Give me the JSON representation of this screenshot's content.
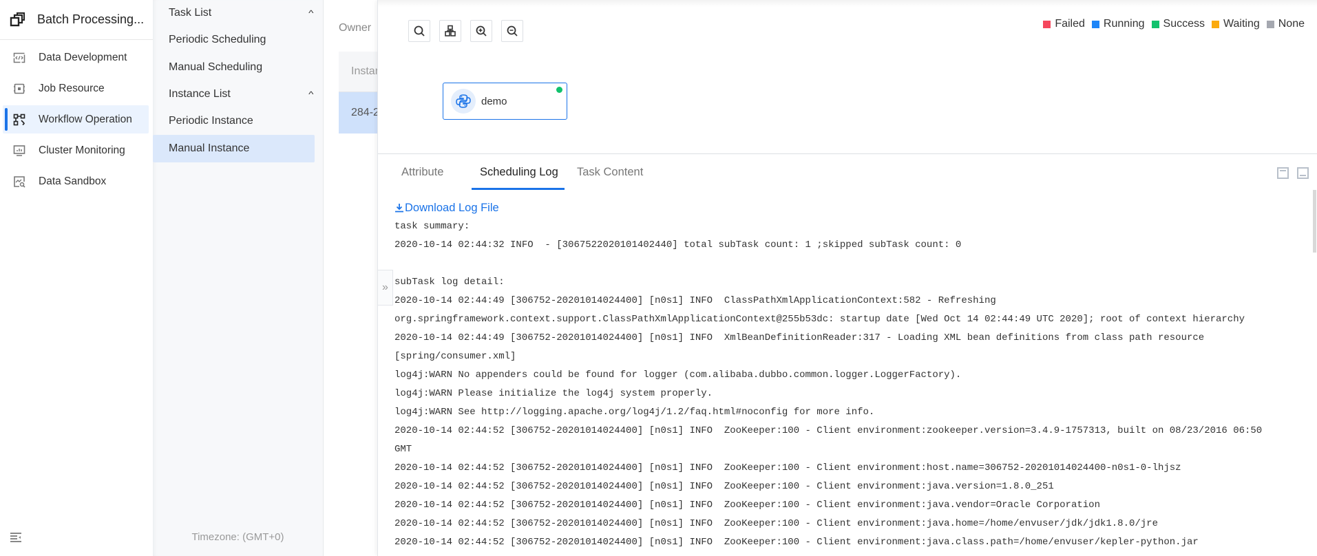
{
  "app": {
    "title": "Batch Processing..."
  },
  "nav": {
    "items": [
      {
        "label": "Data Development",
        "icon": "code-icon",
        "active": false
      },
      {
        "label": "Job Resource",
        "icon": "chip-icon",
        "active": false
      },
      {
        "label": "Workflow Operation",
        "icon": "workflow-icon",
        "active": true
      },
      {
        "label": "Cluster Monitoring",
        "icon": "monitor-icon",
        "active": false
      },
      {
        "label": "Data Sandbox",
        "icon": "sandbox-icon",
        "active": false
      }
    ],
    "collapse_icon": "collapse-menu-icon"
  },
  "subnav": {
    "groups": [
      {
        "label": "Task List",
        "expanded": true,
        "items": [
          "Periodic Scheduling",
          "Manual Scheduling"
        ]
      },
      {
        "label": "Instance List",
        "expanded": true,
        "items": [
          "Periodic Instance",
          "Manual Instance"
        ]
      }
    ],
    "active_item": "Manual Instance",
    "timezone": "Timezone: (GMT+0)"
  },
  "list": {
    "owner_label": "Owner",
    "column_header": "Instance",
    "row_value": "284-2"
  },
  "canvas": {
    "tools": [
      {
        "name": "search",
        "icon": "search-icon"
      },
      {
        "name": "layout",
        "icon": "layout-tree-icon"
      },
      {
        "name": "zoom-in",
        "icon": "zoom-in-icon"
      },
      {
        "name": "zoom-out",
        "icon": "zoom-out-icon"
      }
    ],
    "legend": [
      {
        "label": "Failed",
        "color": "#f5475d"
      },
      {
        "label": "Running",
        "color": "#1d85f8"
      },
      {
        "label": "Success",
        "color": "#11c26d"
      },
      {
        "label": "Waiting",
        "color": "#fbaa0d"
      },
      {
        "label": "None",
        "color": "#a5a8b0"
      }
    ],
    "node": {
      "name": "demo",
      "icon": "python-icon",
      "status": "Success",
      "status_color": "#11c26d"
    }
  },
  "drawer": {
    "tabs": [
      {
        "label": "Attribute",
        "active": false
      },
      {
        "label": "Scheduling Log",
        "active": true
      },
      {
        "label": "Task Content",
        "active": false
      }
    ],
    "download_label": "Download Log File",
    "expander_glyph": "»",
    "log_lines": [
      "task summary:",
      "2020-10-14 02:44:32 INFO  - [3067522020101402440] total subTask count: 1 ;skipped subTask count: 0",
      "",
      "subTask log detail:",
      "2020-10-14 02:44:49 [306752-20201014024400] [n0s1] INFO  ClassPathXmlApplicationContext:582 - Refreshing",
      "org.springframework.context.support.ClassPathXmlApplicationContext@255b53dc: startup date [Wed Oct 14 02:44:49 UTC 2020]; root of context hierarchy",
      "2020-10-14 02:44:49 [306752-20201014024400] [n0s1] INFO  XmlBeanDefinitionReader:317 - Loading XML bean definitions from class path resource",
      "[spring/consumer.xml]",
      "log4j:WARN No appenders could be found for logger (com.alibaba.dubbo.common.logger.LoggerFactory).",
      "log4j:WARN Please initialize the log4j system properly.",
      "log4j:WARN See http://logging.apache.org/log4j/1.2/faq.html#noconfig for more info.",
      "2020-10-14 02:44:52 [306752-20201014024400] [n0s1] INFO  ZooKeeper:100 - Client environment:zookeeper.version=3.4.9-1757313, built on 08/23/2016 06:50",
      "GMT",
      "2020-10-14 02:44:52 [306752-20201014024400] [n0s1] INFO  ZooKeeper:100 - Client environment:host.name=306752-20201014024400-n0s1-0-lhjsz",
      "2020-10-14 02:44:52 [306752-20201014024400] [n0s1] INFO  ZooKeeper:100 - Client environment:java.version=1.8.0_251",
      "2020-10-14 02:44:52 [306752-20201014024400] [n0s1] INFO  ZooKeeper:100 - Client environment:java.vendor=Oracle Corporation",
      "2020-10-14 02:44:52 [306752-20201014024400] [n0s1] INFO  ZooKeeper:100 - Client environment:java.home=/home/envuser/jdk/jdk1.8.0/jre",
      "2020-10-14 02:44:52 [306752-20201014024400] [n0s1] INFO  ZooKeeper:100 - Client environment:java.class.path=/home/envuser/kepler-python.jar"
    ]
  }
}
